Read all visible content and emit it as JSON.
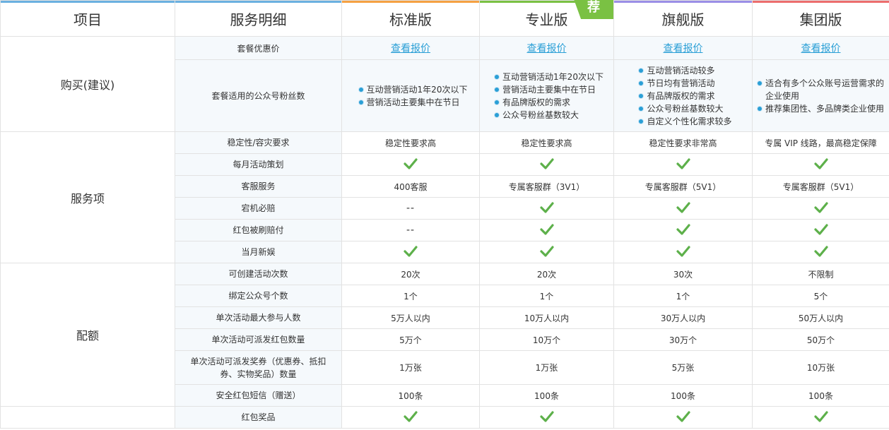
{
  "header": {
    "item_col": "项目",
    "detail_col": "服务明细",
    "plans": [
      {
        "name": "标准版",
        "color": "#f5a142"
      },
      {
        "name": "专业版",
        "color": "#7ac143",
        "badge": "荐"
      },
      {
        "name": "旗舰版",
        "color": "#9a8ee6"
      },
      {
        "name": "集团版",
        "color": "#ec6d6d"
      }
    ],
    "item_bar_color": "#6ab0e0"
  },
  "sections": {
    "purchase": {
      "label": "购买(建议)",
      "price_row": {
        "label": "套餐优惠价",
        "links": [
          "查看报价",
          "查看报价",
          "查看报价",
          "查看报价"
        ]
      },
      "fans_row": {
        "label": "套餐适用的公众号粉丝数",
        "plans": [
          [
            "互动营销活动1年20次以下",
            "营销活动主要集中在节日"
          ],
          [
            "互动营销活动1年20次以下",
            "营销活动主要集中在节日",
            "有品牌版权的需求",
            "公众号粉丝基数较大"
          ],
          [
            "互动营销活动较多",
            "节日均有营销活动",
            "有品牌版权的需求",
            "公众号粉丝基数较大",
            "自定义个性化需求较多"
          ],
          [
            "适合有多个公众账号运营需求的企业使用",
            "推荐集团性、多品牌类企业使用"
          ]
        ]
      }
    },
    "service": {
      "label": "服务项",
      "rows": [
        {
          "label": "稳定性/容灾要求",
          "values": [
            "稳定性要求高",
            "稳定性要求高",
            "稳定性要求非常高",
            "专属 VIP 线路，最高稳定保障"
          ]
        },
        {
          "label": "每月活动策划",
          "values": [
            "check",
            "check",
            "check",
            "check"
          ]
        },
        {
          "label": "客服服务",
          "values": [
            "400客服",
            "专属客服群（3V1）",
            "专属客服群（5V1）",
            "专属客服群（5V1）"
          ]
        },
        {
          "label": "宕机必赔",
          "values": [
            "--",
            "check",
            "check",
            "check"
          ]
        },
        {
          "label": "红包被刷赔付",
          "values": [
            "--",
            "check",
            "check",
            "check"
          ]
        },
        {
          "label": "当月新娱",
          "values": [
            "check",
            "check",
            "check",
            "check"
          ]
        }
      ]
    },
    "quota": {
      "label": "配额",
      "rows": [
        {
          "label": "可创建活动次数",
          "values": [
            "20次",
            "20次",
            "30次",
            "不限制"
          ]
        },
        {
          "label": "绑定公众号个数",
          "values": [
            "1个",
            "1个",
            "1个",
            "5个"
          ]
        },
        {
          "label": "单次活动最大参与人数",
          "values": [
            "5万人以内",
            "10万人以内",
            "30万人以内",
            "50万人以内"
          ]
        },
        {
          "label": "单次活动可派发红包数量",
          "values": [
            "5万个",
            "10万个",
            "30万个",
            "50万个"
          ]
        },
        {
          "label": "单次活动可派发奖券（优惠券、抵扣券、实物奖品）数量",
          "values": [
            "1万张",
            "1万张",
            "5万张",
            "10万张"
          ]
        },
        {
          "label": "安全红包短信（赠送）",
          "values": [
            "100条",
            "100条",
            "100条",
            "100条"
          ]
        }
      ]
    },
    "extra": {
      "rows": [
        {
          "label": "红包奖品",
          "values": [
            "check",
            "check",
            "check",
            "check"
          ]
        }
      ]
    }
  },
  "colors": {
    "check": "#5db04a",
    "link": "#2a9fd6"
  }
}
